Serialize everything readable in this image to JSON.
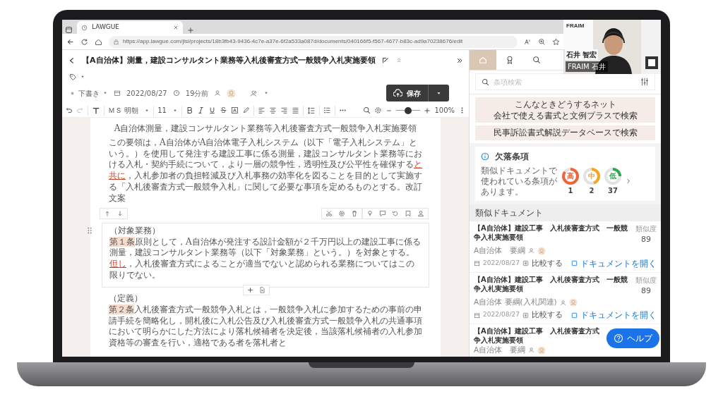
{
  "browser": {
    "tab_title": "LAWGUE",
    "url": "https://app.lawgue.com/jlsi/projects/18b3fb43-9436-4c7e-a37e-6f2a533a087d/documents/040166f5-f567-4677-b83c-ad9a70238676/edit"
  },
  "header": {
    "title": "【A自治体】測量，建設コンサルタント業務等入札後審査方式一般競争入札実施要領",
    "status": "下書き",
    "date": "2022/08/27",
    "time_ago": "19分前",
    "save_label": "保存"
  },
  "toolbar": {
    "font": "ＭＳ 明朝",
    "size": "11",
    "zoom": "100%",
    "zoom_slider": {
      "level": 0.5
    }
  },
  "document": {
    "heading": "A自治体測量，建設コンサルタント業務等入札後審査方式一般競争入札実施要領",
    "blocks": [
      {
        "kind": "plain",
        "selected": false,
        "segments": [
          {
            "text": "この要領は，A自治体がA自治体電子入札システム（以下「電子入札システム」という。）を使用して発注する建設工事に係る測量，建設コンサルタント業務等における入札・契約手続について，より一層の競争性，透明性及び公平性を確保する",
            "mark": false
          },
          {
            "text": "と共に",
            "mark": true
          },
          {
            "text": "，入札参加者の負担軽減及び入札事務の効率化を図ることを目的として実施する「入札後審査方式一般競争入札」に関して必要な事項を定めるものとする。改訂文案",
            "mark": false
          }
        ]
      },
      {
        "kind": "article",
        "selected": true,
        "caption": "（対象業務）",
        "number": "第１条",
        "segments": [
          {
            "text": "原則として，A自治体が発注する設計金額が２千万円以上の建設工事に係る測量，建設コンサルタント業務等（以下「対象業務」という。）を対象とする。",
            "mark": false
          },
          {
            "text": "但し",
            "mark": true
          },
          {
            "text": "，入札後審査方式によることが適当でないと認められる業務についてはこの限りでない。",
            "mark": false
          }
        ]
      },
      {
        "kind": "article",
        "selected": false,
        "caption": "（定義）",
        "number": "第２条",
        "segments": [
          {
            "text": "入札後審査方式一般競争入札とは，一般競争入札に参加するための事前の申請手続を簡略化し，開札後に入札公告及び入札後審査方式一般競争入札の共通事項において明らかにした方法により落札候補者を決定後，当該落札候補者の入札参加資格等の審査を行い，適格である者を落札者と",
            "mark": false
          }
        ]
      }
    ]
  },
  "panel": {
    "tabs": [
      {
        "kind": "home",
        "selected": true
      },
      {
        "kind": "award",
        "selected": false
      },
      {
        "kind": "search",
        "selected": false
      }
    ],
    "search": {
      "placeholder": "条項検索"
    },
    "links": [
      {
        "lines": [
          "こんなときどうするネット",
          "会社で使える書式と文例プラスで検索"
        ]
      },
      {
        "lines": [
          "民事訴訟書式解説データベースで検索"
        ]
      }
    ],
    "missing": {
      "title": "欠落条項",
      "description": "類似ドキュメントで使われている条項があります。",
      "levels": [
        {
          "label": "高",
          "count": "1",
          "color": "#f0643a",
          "level": 0.85
        },
        {
          "label": "中",
          "count": "2",
          "color": "#f5a623",
          "level": 0.45
        },
        {
          "label": "低",
          "count": "37",
          "color": "#2fa84f",
          "level": 0.25
        }
      ]
    },
    "similar": {
      "title": "類似ドキュメント",
      "items": [
        {
          "title_lines": [
            "【A自治体】建設工事　入札後審査方式　一般競",
            "争入札実施要領"
          ],
          "tags": "A自治体　要綱",
          "date": "2022/08/27",
          "score_label": "類似度",
          "score": "89",
          "compare": "比較する",
          "open": "ドキュメントを開く"
        },
        {
          "title_lines": [
            "【A自治体】建設工事　入札後審査方式　一般競",
            "争入札実施要領"
          ],
          "tags": "A自治体 要綱(入札関連)",
          "date": "2022/08/27",
          "score_label": "類似度",
          "score": "89",
          "compare": "比較する",
          "open": "ドキュメントを開く"
        },
        {
          "title_lines": [
            "【A自治体】建設工事　入札後審査方式",
            "争入札実施要領"
          ],
          "tags": "A自治体　要綱"
        }
      ]
    }
  },
  "help": {
    "label": "ヘルプ"
  },
  "webcam": {
    "company": "FRAIM",
    "name": "石井 智宏",
    "caption": "FRAIM 石井"
  }
}
